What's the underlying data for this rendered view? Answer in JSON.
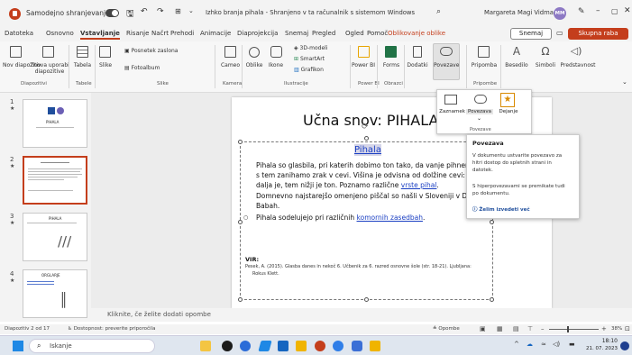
{
  "titlebar": {
    "autosave_label": "Samodejno shranjevanje",
    "doc_title": "Izhko branja pihala - Shranjeno v ta računalnik s sistemom Windows",
    "user_name": "Margareta Magi Vidmar",
    "user_initials": "MM"
  },
  "menu": {
    "tabs": [
      "Datoteka",
      "Osnovno",
      "Vstavljanje",
      "Risanje",
      "Načrt",
      "Prehodi",
      "Animacije",
      "Diaprojekcija",
      "Snemaj",
      "Pregled",
      "Ogled",
      "Pomoč",
      "Oblikovanje oblike"
    ],
    "active": "Vstavljanje",
    "record_label": "Snemaj",
    "share_label": "Skupna raba"
  },
  "ribbon": {
    "new_slide": "Nov diapozitiv",
    "reuse_slides": "Znova uporabi diapozitive",
    "table": "Tabela",
    "pictures": "Slike",
    "screenshot": "Posnetek zaslona",
    "photo_album": "Fotoalbum",
    "cameo": "Cameo",
    "shapes": "Oblike",
    "icons": "Ikone",
    "models_3d": "3D-modeli",
    "smartart": "SmartArt",
    "chart": "Grafikon",
    "power_bi": "Power BI",
    "forms": "Forms",
    "addins": "Dodatki",
    "links": "Povezave",
    "comment": "Pripomba",
    "text": "Besedilo",
    "symbols": "Simboli",
    "media": "Predstavnost",
    "groups": [
      "Diapozitivi",
      "Tabele",
      "Slike",
      "Kamera",
      "Ilustracije",
      "Power BI",
      "Obrazci",
      "Pripombe"
    ]
  },
  "links_dropdown": {
    "items": [
      "Zaznamek",
      "Povezava",
      "Dejanje"
    ],
    "group": "Povezave"
  },
  "tooltip": {
    "title": "Povezava",
    "body": "V dokumentu ustvarite povezavo za hitri dostop do spletnih strani in datotek.",
    "body2": "S hiperpovezavami se premikate tudi po dokumentu.",
    "more": "Želim izvedeti več"
  },
  "slides": {
    "numbers": [
      "1",
      "2",
      "3",
      "4"
    ],
    "thumb1_title": "PIHALA",
    "thumb3_title": "PIHALA",
    "thumb4_title": "ORGLARJE"
  },
  "slide": {
    "title": "Učna snov: PIHALA",
    "heading": "Pihala",
    "bullet1_lines": [
      "Pihala so glasbila, pri katerih dobimo ton tako, da vanje pihnemo",
      "s tem zanihamo zrak v cevi. Višina je odvisna od dolžine cevi: č",
      "dalja je, tem nižji je ton. Poznamo različne"
    ],
    "bullet1_link": "vrste pihal",
    "bullet2_lines": [
      "Domnevno najstarejšo omenjeno piščal so našli v Sloveniji v D",
      "Babah."
    ],
    "bullet3_text": "Pihala sodelujejo pri različnih",
    "bullet3_link": "komornih zasedbah",
    "source_label": "VIR:",
    "source_lines": [
      "Pesek, A. (2015). Glasba danes in nekoč 6. Učbenik za 6. razred osnovne šole (str. 18-21). Ljubljana:",
      "Rokus Klett."
    ]
  },
  "notes_placeholder": "Kliknite, če želite dodati opombe",
  "status": {
    "slide_info": "Diapozitiv 2 od 17",
    "accessibility": "Dostopnost: preverite priporočila",
    "notes": "Opombe",
    "zoom": "38%"
  },
  "taskbar": {
    "search": "Iskanje",
    "time": "18:10",
    "date": "21. 07. 2023"
  }
}
